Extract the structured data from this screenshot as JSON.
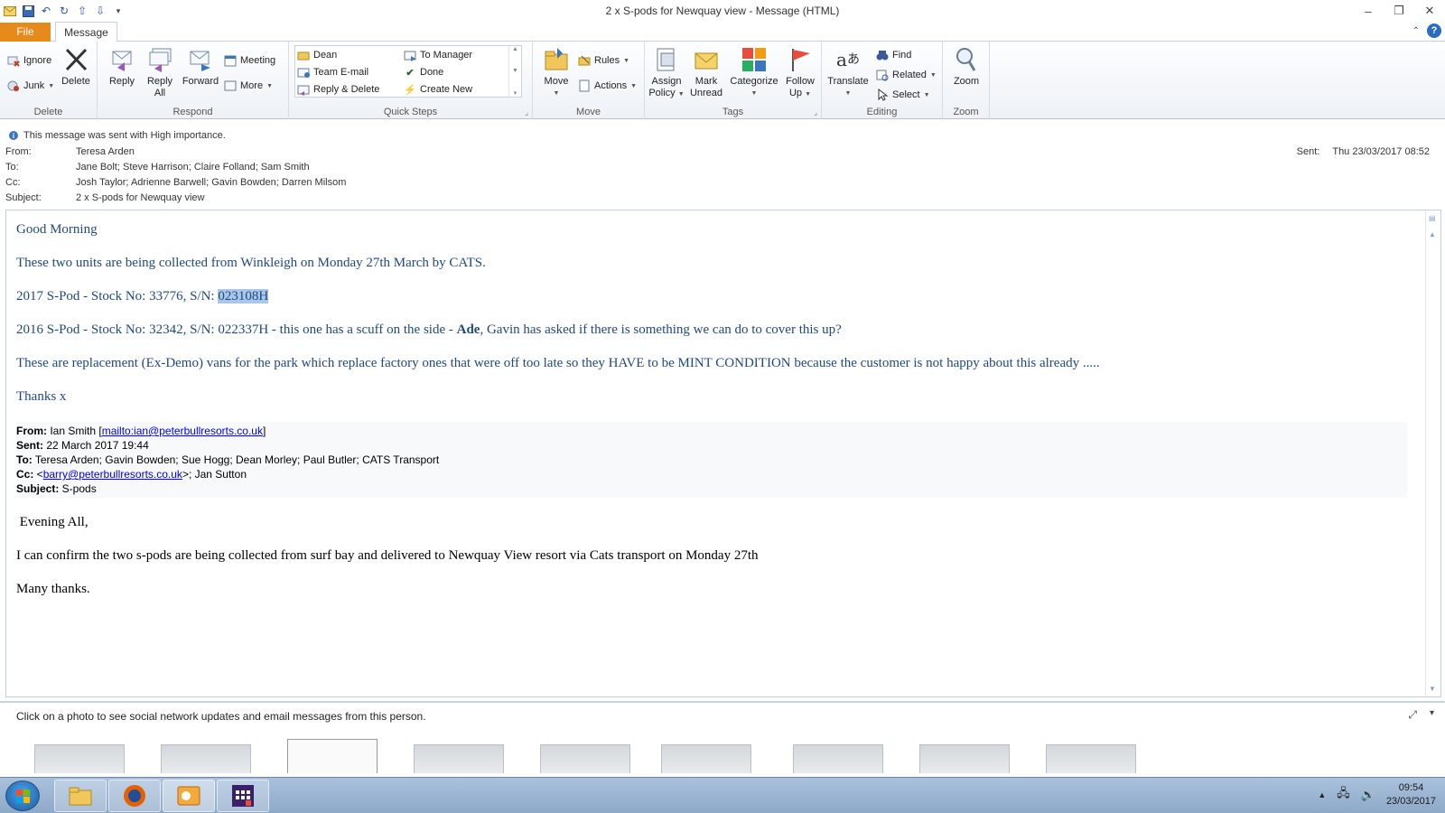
{
  "window": {
    "title": "2 x S-pods for Newquay view  -  Message (HTML)"
  },
  "tabs": {
    "file": "File",
    "message": "Message"
  },
  "ribbon": {
    "delete_group": {
      "label": "Delete",
      "ignore": "Ignore",
      "junk": "Junk",
      "delete": "Delete"
    },
    "respond_group": {
      "label": "Respond",
      "reply": "Reply",
      "reply_all_1": "Reply",
      "reply_all_2": "All",
      "forward": "Forward",
      "meeting": "Meeting",
      "more": "More"
    },
    "quick_steps": {
      "label": "Quick Steps",
      "dean": "Dean",
      "team_email": "Team E-mail",
      "reply_delete": "Reply & Delete",
      "to_manager": "To Manager",
      "done": "Done",
      "create_new": "Create New"
    },
    "move_group": {
      "label": "Move",
      "move": "Move",
      "rules": "Rules",
      "actions": "Actions"
    },
    "tags_group": {
      "label": "Tags",
      "assign_1": "Assign",
      "assign_2": "Policy",
      "mark_1": "Mark",
      "mark_2": "Unread",
      "categorize": "Categorize",
      "follow_1": "Follow",
      "follow_2": "Up"
    },
    "editing_group": {
      "label": "Editing",
      "translate": "Translate",
      "find": "Find",
      "related": "Related",
      "select": "Select"
    },
    "zoom_group": {
      "label": "Zoom",
      "zoom": "Zoom"
    }
  },
  "header": {
    "importance": "This message was sent with High importance.",
    "from_label": "From:",
    "from": "Teresa Arden",
    "to_label": "To:",
    "to": "Jane Bolt; Steve Harrison; Claire Folland; Sam Smith",
    "cc_label": "Cc:",
    "cc": "Josh Taylor; Adrienne Barwell; Gavin Bowden; Darren Milsom",
    "subject_label": "Subject:",
    "subject": "2 x S-pods for Newquay view",
    "sent_label": "Sent:",
    "sent": "Thu 23/03/2017 08:52"
  },
  "body": {
    "greeting": "Good Morning",
    "line1": "These two units are being collected from Winkleigh on Monday 27th March by CATS.",
    "line2_prefix": "2017 S-Pod - Stock No: 33776, S/N: ",
    "line2_sn": "023108H",
    "line3_prefix": "2016 S-Pod - Stock No: 32342, S/N: 022337H - this one has a scuff on the side - ",
    "line3_bold": "Ade",
    "line3_suffix": ", Gavin has asked if there is something we can do to cover this up?",
    "line4": "These are replacement (Ex-Demo) vans for the park which replace factory ones that were off too late so they HAVE to be MINT CONDITION because the customer is not happy about this already .....",
    "thanks": "Thanks x",
    "quoted": {
      "from_label": "From:",
      "from_name": " Ian Smith [",
      "from_link": "mailto:ian@peterbullresorts.co.uk",
      "from_close": "]",
      "sent_label": "Sent:",
      "sent": " 22 March 2017 19:44",
      "to_label": "To:",
      "to": " Teresa Arden; Gavin Bowden; Sue Hogg; Dean Morley; Paul Butler; CATS Transport",
      "cc_label": "Cc:",
      "cc_open": " <",
      "cc_link": "barry@peterbullresorts.co.uk",
      "cc_rest": ">; Jan Sutton",
      "subject_label": "Subject:",
      "subject": " S-pods"
    },
    "evening": " Evening All,",
    "confirm": "I can confirm the two s-pods are being collected from surf bay and delivered to Newquay View resort via Cats transport on Monday 27th",
    "many_thanks": "Many thanks."
  },
  "people_pane": {
    "hint": "Click on a photo to see social network updates and email messages from this person."
  },
  "taskbar": {
    "time": "09:54",
    "date": "23/03/2017"
  },
  "colors": {
    "file_tab": "#e68a1c",
    "body_text": "#1f497d",
    "selection": "#a9c7ea"
  }
}
